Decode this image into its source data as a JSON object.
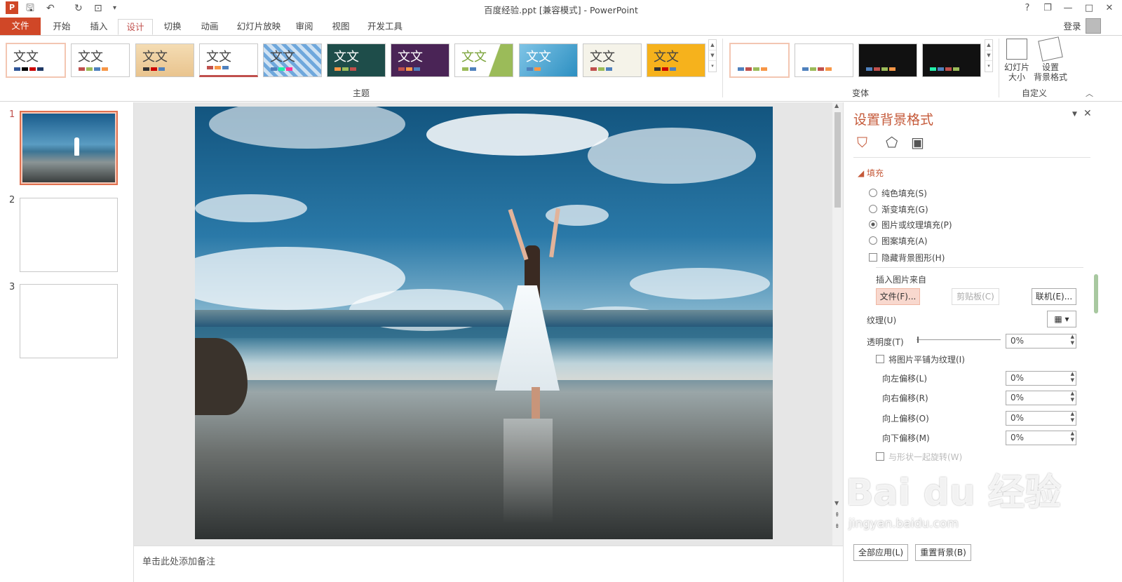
{
  "window": {
    "title": "百度经验.ppt [兼容模式] - PowerPoint",
    "help": "?",
    "restore": "❐",
    "minimize": "—",
    "maximize": "□",
    "close": "✕",
    "login": "登录"
  },
  "tabs": [
    "文件",
    "开始",
    "插入",
    "设计",
    "切换",
    "动画",
    "幻灯片放映",
    "审阅",
    "视图",
    "开发工具"
  ],
  "ribbon": {
    "themes_label": "主题",
    "variants_label": "变体",
    "custom_label": "自定义",
    "theme_text": "文文",
    "slide_size": "幻灯片\n大小",
    "format_bg": "设置\n背景格式"
  },
  "thumbs": [
    "1",
    "2",
    "3"
  ],
  "notes": "单击此处添加备注",
  "pane": {
    "title": "设置背景格式",
    "section": "填充",
    "solid": "纯色填充(S)",
    "gradient": "渐变填充(G)",
    "picture": "图片或纹理填充(P)",
    "pattern": "图案填充(A)",
    "hide_bg": "隐藏背景图形(H)",
    "insert_from": "插入图片来自",
    "file_btn": "文件(F)...",
    "clipboard_btn": "剪贴板(C)",
    "online_btn": "联机(E)...",
    "texture": "纹理(U)",
    "transparency": "透明度(T)",
    "transparency_val": "0%",
    "tile": "将图片平铺为纹理(I)",
    "offset_left": "向左偏移(L)",
    "offset_right": "向右偏移(R)",
    "offset_up": "向上偏移(O)",
    "offset_down": "向下偏移(M)",
    "zero": "0%",
    "rotate": "与形状一起旋转(W)",
    "apply_all": "全部应用(L)",
    "reset": "重置背景(B)"
  },
  "watermark": {
    "logo": "Bai du 经验",
    "url": "jingyan.baidu.com"
  }
}
